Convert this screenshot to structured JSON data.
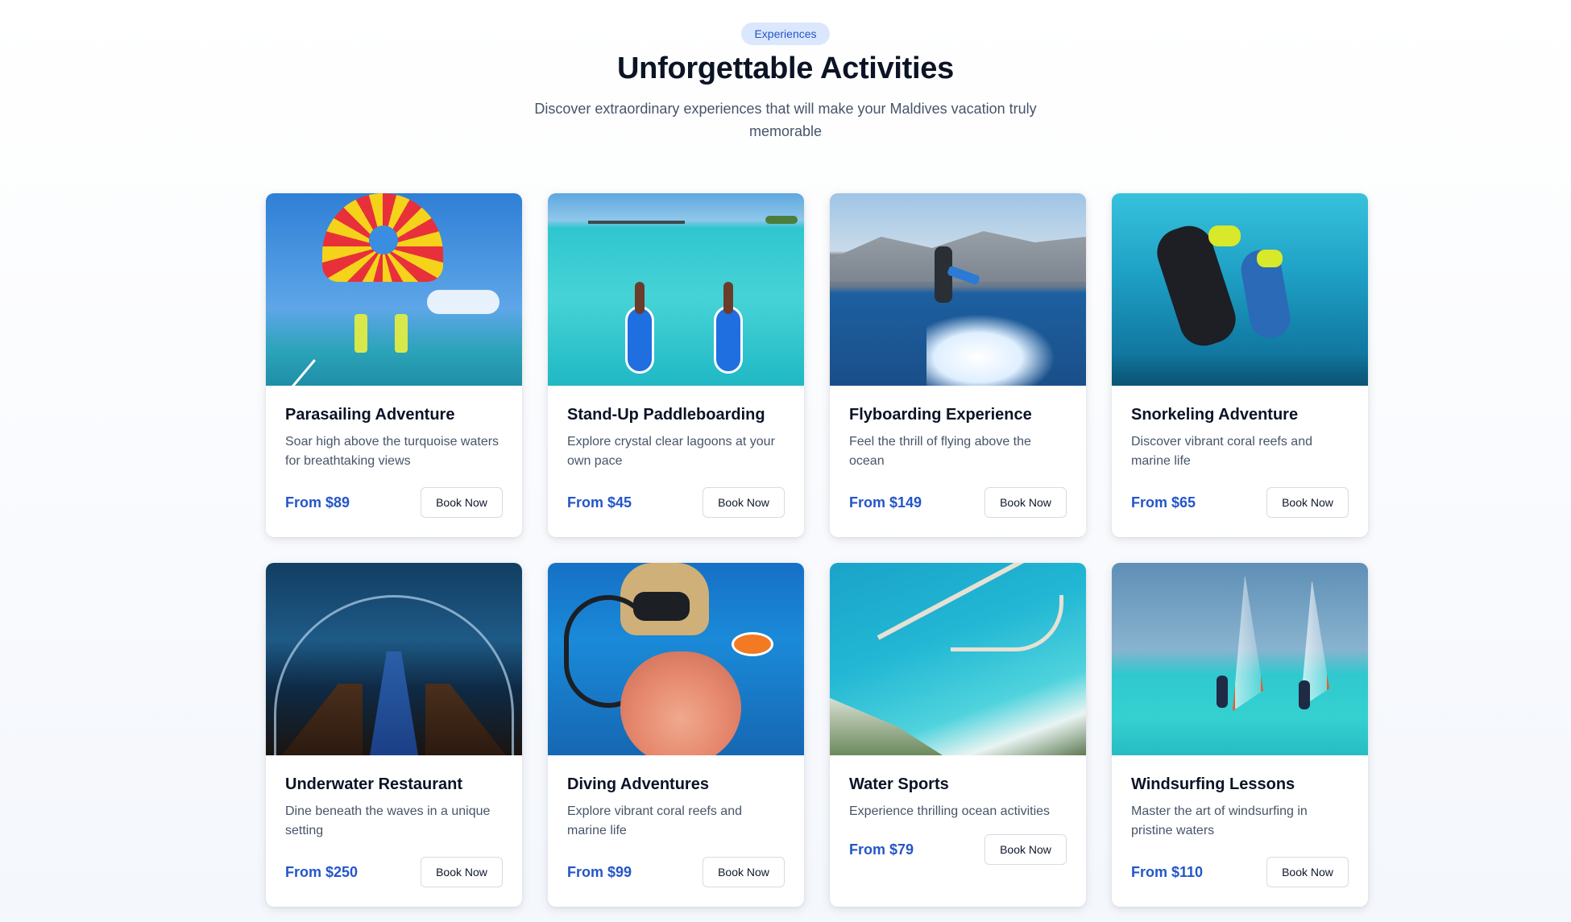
{
  "header": {
    "badge": "Experiences",
    "title": "Unforgettable Activities",
    "subtitle": "Discover extraordinary experiences that will make your Maldives vacation truly memorable"
  },
  "activities": [
    {
      "name": "Parasailing Adventure",
      "description": "Soar high above the turquoise waters for breathtaking views",
      "price": "From $89",
      "button": "Book Now"
    },
    {
      "name": "Stand-Up Paddleboarding",
      "description": "Explore crystal clear lagoons at your own pace",
      "price": "From $45",
      "button": "Book Now"
    },
    {
      "name": "Flyboarding Experience",
      "description": "Feel the thrill of flying above the ocean",
      "price": "From $149",
      "button": "Book Now"
    },
    {
      "name": "Snorkeling Adventure",
      "description": "Discover vibrant coral reefs and marine life",
      "price": "From $65",
      "button": "Book Now"
    },
    {
      "name": "Underwater Restaurant",
      "description": "Dine beneath the waves in a unique setting",
      "price": "From $250",
      "button": "Book Now"
    },
    {
      "name": "Diving Adventures",
      "description": "Explore vibrant coral reefs and marine life",
      "price": "From $99",
      "button": "Book Now"
    },
    {
      "name": "Water Sports",
      "description": "Experience thrilling ocean activities",
      "price": "From $79",
      "button": "Book Now"
    },
    {
      "name": "Windsurfing Lessons",
      "description": "Master the art of windsurfing in pristine waters",
      "price": "From $110",
      "button": "Book Now"
    }
  ],
  "colors": {
    "accent": "#2456c8",
    "badge_bg": "#dbe7fd"
  }
}
